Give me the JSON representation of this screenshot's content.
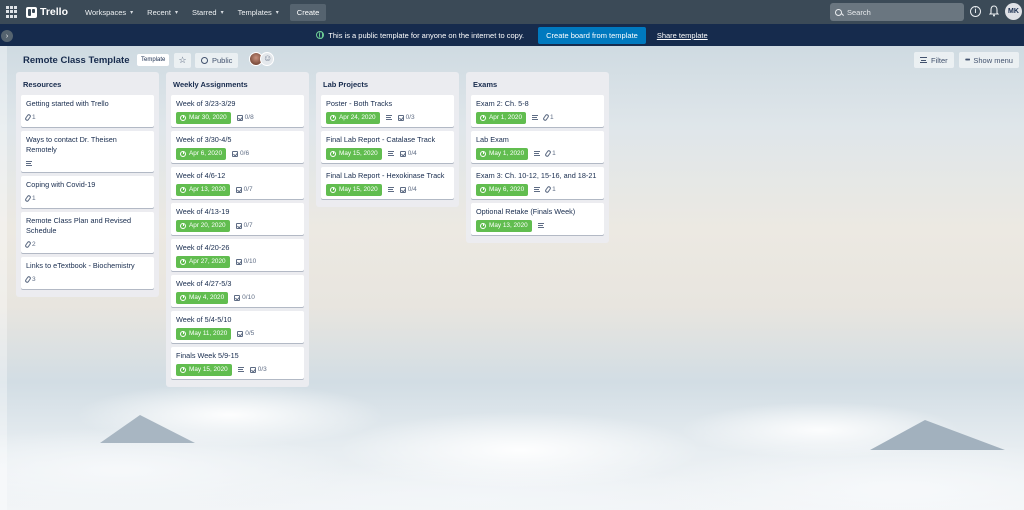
{
  "topnav": {
    "logo": "Trello",
    "items": [
      {
        "label": "Workspaces"
      },
      {
        "label": "Recent"
      },
      {
        "label": "Starred"
      },
      {
        "label": "Templates"
      }
    ],
    "create_label": "Create",
    "search_placeholder": "Search",
    "avatar_initials": "MK"
  },
  "banner": {
    "text": "This is a public template for anyone on the internet to copy.",
    "create_button": "Create board from template",
    "share_link": "Share template"
  },
  "board": {
    "title": "Remote Class Template",
    "badge": "Template",
    "visibility": "Public",
    "filter_label": "Filter",
    "menu_label": "Show menu"
  },
  "lists": [
    {
      "title": "Resources",
      "cards": [
        {
          "title": "Getting started with Trello",
          "attachments": "1"
        },
        {
          "title": "Ways to contact Dr. Theisen Remotely",
          "description": true
        },
        {
          "title": "Coping with Covid-19",
          "attachments": "1"
        },
        {
          "title": "Remote Class Plan and Revised Schedule",
          "attachments": "2"
        },
        {
          "title": "Links to eTextbook - Biochemistry",
          "attachments": "3"
        }
      ]
    },
    {
      "title": "Weekly Assignments",
      "cards": [
        {
          "title": "Week of 3/23-3/29",
          "due": "Mar 30, 2020",
          "checklist": "0/8"
        },
        {
          "title": "Week of 3/30-4/5",
          "due": "Apr 6, 2020",
          "checklist": "0/6"
        },
        {
          "title": "Week of 4/6-12",
          "due": "Apr 13, 2020",
          "checklist": "0/7"
        },
        {
          "title": "Week of 4/13-19",
          "due": "Apr 20, 2020",
          "checklist": "0/7"
        },
        {
          "title": "Week of 4/20-26",
          "due": "Apr 27, 2020",
          "checklist": "0/10"
        },
        {
          "title": "Week of 4/27-5/3",
          "due": "May 4, 2020",
          "checklist": "0/10"
        },
        {
          "title": "Week of 5/4-5/10",
          "due": "May 11, 2020",
          "checklist": "0/5"
        },
        {
          "title": "Finals Week 5/9-15",
          "due": "May 15, 2020",
          "description": true,
          "checklist": "0/3"
        }
      ]
    },
    {
      "title": "Lab Projects",
      "cards": [
        {
          "title": "Poster - Both Tracks",
          "due": "Apr 24, 2020",
          "description": true,
          "checklist": "0/3"
        },
        {
          "title": "Final Lab Report - Catalase Track",
          "due": "May 15, 2020",
          "description": true,
          "checklist": "0/4"
        },
        {
          "title": "Final Lab Report - Hexokinase Track",
          "due": "May 15, 2020",
          "description": true,
          "checklist": "0/4"
        }
      ]
    },
    {
      "title": "Exams",
      "cards": [
        {
          "title": "Exam 2: Ch. 5-8",
          "due": "Apr 1, 2020",
          "description": true,
          "attachments": "1"
        },
        {
          "title": "Lab Exam",
          "due": "May 1, 2020",
          "description": true,
          "attachments": "1"
        },
        {
          "title": "Exam 3: Ch. 10-12, 15-16, and 18-21",
          "due": "May 6, 2020",
          "description": true,
          "attachments": "1"
        },
        {
          "title": "Optional Retake (Finals Week)",
          "due": "May 13, 2020",
          "description": true
        }
      ]
    }
  ],
  "colors": {
    "nav_bg": "#3b4a57",
    "banner_bg": "#162b4d",
    "accent_button": "#0079bf",
    "due_badge": "#61bd4f"
  }
}
